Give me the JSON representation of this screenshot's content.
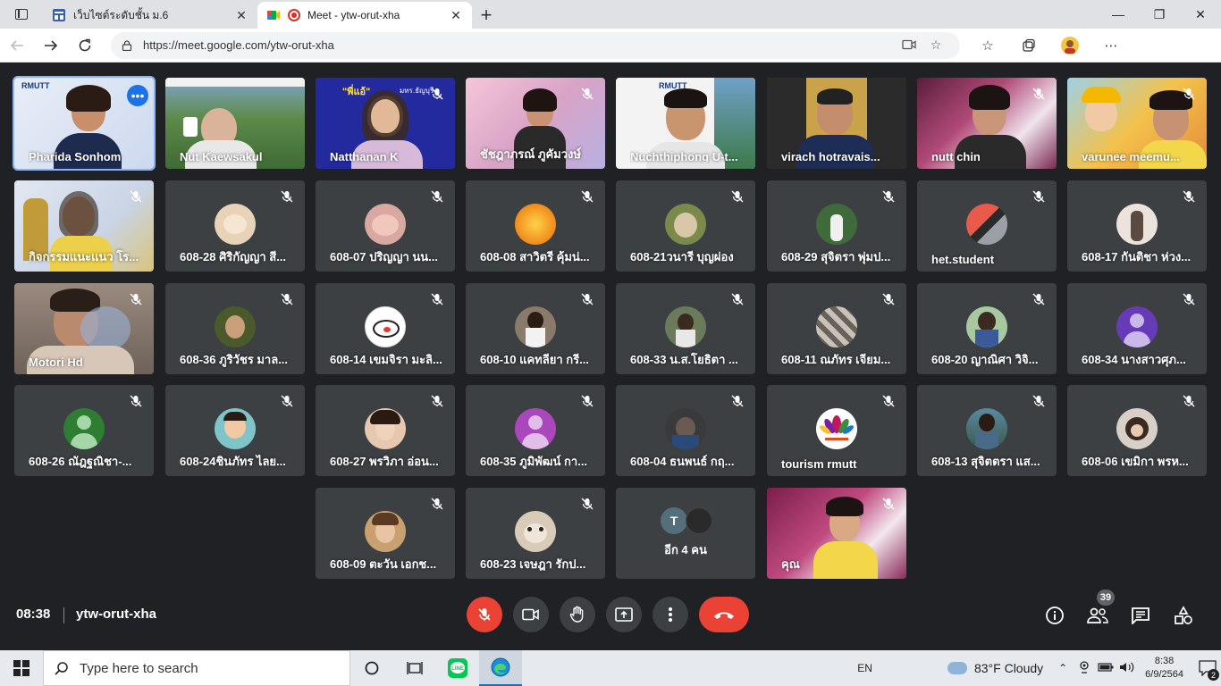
{
  "browser": {
    "tabs": [
      {
        "title": "เว็บไซต์ระดับชั้น ม.6",
        "active": false
      },
      {
        "title": "Meet - ytw-orut-xha",
        "active": true
      }
    ],
    "url": "https://meet.google.com/ytw-orut-xha"
  },
  "meeting": {
    "time": "08:38",
    "code": "ytw-orut-xha",
    "participant_count": "39",
    "participants": [
      {
        "name": "Pharida Sonhom",
        "video": true,
        "muted": false
      },
      {
        "name": "Nut Kaewsakul",
        "video": true,
        "muted": false
      },
      {
        "name": "Natthanan K",
        "video": true,
        "muted": true
      },
      {
        "name": "ชัชฎาภรณ์ ภูคัมวงษ์",
        "video": true,
        "muted": true
      },
      {
        "name": "Nuchthiphong U-t...",
        "video": true,
        "muted": false
      },
      {
        "name": "virach hotravais...",
        "video": true,
        "muted": false
      },
      {
        "name": "nutt chin",
        "video": true,
        "muted": true
      },
      {
        "name": "varunee meemu...",
        "video": true,
        "muted": true
      },
      {
        "name": "กิจกรรมแนะแนว โร...",
        "video": true,
        "muted": true
      },
      {
        "name": "608-28 ศิริกัญญา สี...",
        "video": false,
        "muted": true
      },
      {
        "name": "608-07 ปริญญา นน...",
        "video": false,
        "muted": true
      },
      {
        "name": "608-08 สาวิตรี คุ้มน่...",
        "video": false,
        "muted": true
      },
      {
        "name": "608-21วนารี บุญผ่อง",
        "video": false,
        "muted": true
      },
      {
        "name": "608-29 สุจิตรา พุ่มป...",
        "video": false,
        "muted": true
      },
      {
        "name": "het.student",
        "video": false,
        "muted": true
      },
      {
        "name": "608-17 กันติชา ห่วง...",
        "video": false,
        "muted": true
      },
      {
        "name": "Motori Hd",
        "video": true,
        "muted": true
      },
      {
        "name": "608-36 ภูริวัชร มาล...",
        "video": false,
        "muted": true
      },
      {
        "name": "608-14 เขมจิรา มะลิ...",
        "video": false,
        "muted": true
      },
      {
        "name": "608-10 แคทลียา กรี...",
        "video": false,
        "muted": true
      },
      {
        "name": "608-33 น.ส.โยธิตา ...",
        "video": false,
        "muted": true
      },
      {
        "name": "608-11 ณภัทร เจียม...",
        "video": false,
        "muted": true
      },
      {
        "name": "608-20 ญาณิศา วิจิ...",
        "video": false,
        "muted": true
      },
      {
        "name": "608-34 นางสาวศุภ...",
        "video": false,
        "muted": true
      },
      {
        "name": "608-26 ณัฎฐณิชา-...",
        "video": false,
        "muted": true
      },
      {
        "name": "608-24ชินภัทร ไลย...",
        "video": false,
        "muted": true
      },
      {
        "name": "608-27 พรวิภา อ่อน...",
        "video": false,
        "muted": true
      },
      {
        "name": "608-35 ภูมิพัฒน์ กา...",
        "video": false,
        "muted": true
      },
      {
        "name": "608-04 ธนพนธ์ กฤ...",
        "video": false,
        "muted": true
      },
      {
        "name": "tourism rmutt",
        "video": false,
        "muted": true
      },
      {
        "name": "608-13 สุจิตตรา แส...",
        "video": false,
        "muted": true
      },
      {
        "name": "608-06 เขมิกา พรห...",
        "video": false,
        "muted": true
      },
      {
        "name": "608-09 ตะวัน เอกช...",
        "video": false,
        "muted": true
      },
      {
        "name": "608-23 เจษฎา รักป...",
        "video": false,
        "muted": true
      }
    ],
    "more_tile_label": "อีก 4 คน",
    "more_tile_initial": "T",
    "self_label": "คุณ",
    "tile_logo_text": "RMUTT",
    "tile_caption_natthanan": "\"พี่แอ้\"",
    "tile_caption_natthanan_sub": "มทร.ธัญบุรี"
  },
  "taskbar": {
    "search_placeholder": "Type here to search",
    "language": "EN",
    "weather": "83°F  Cloudy",
    "time": "8:38",
    "date": "6/9/2564",
    "notification_count": "2"
  },
  "colors": {
    "meet_bg": "#202124",
    "tile_bg": "#3c4043",
    "end_call": "#ea4335",
    "accent_blue": "#1a73e8"
  }
}
